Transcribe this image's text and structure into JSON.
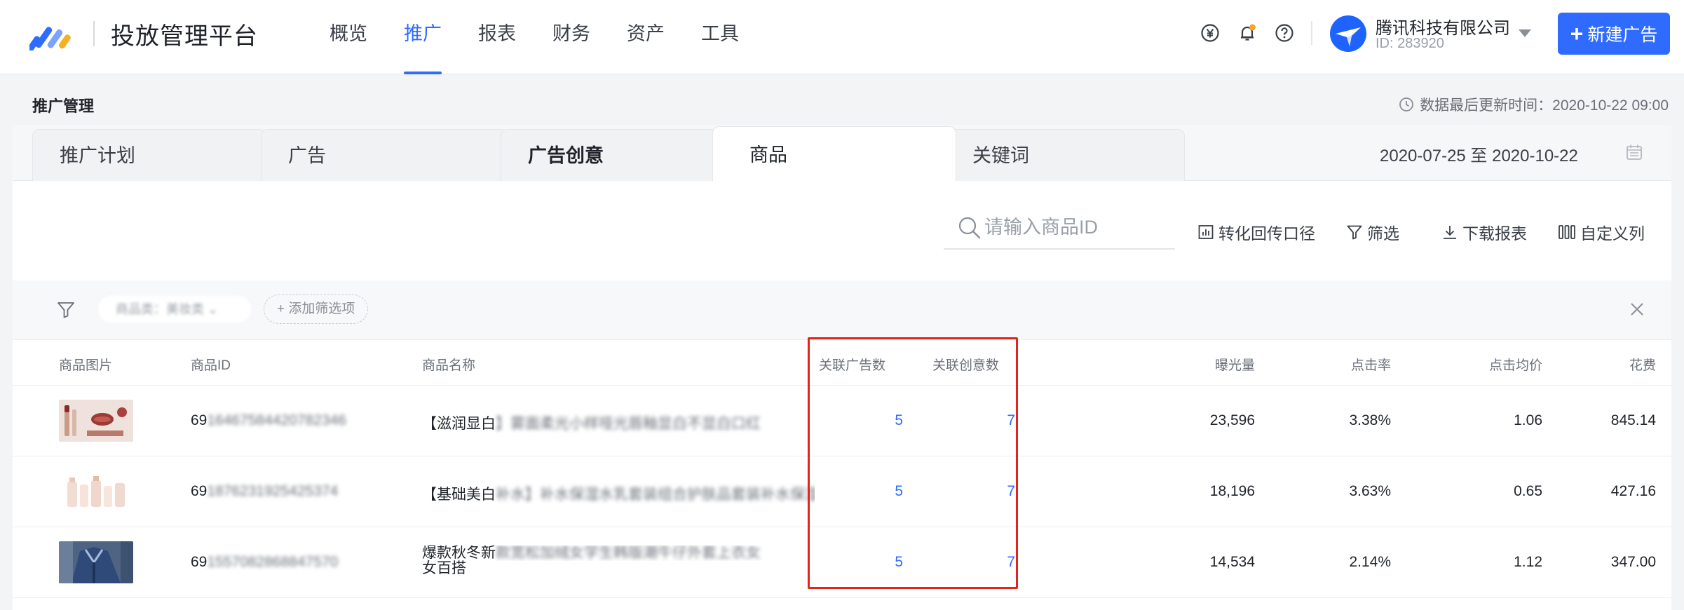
{
  "brand": {
    "name": "投放管理平台",
    "logo_icon": "platform-logo-icon"
  },
  "nav": {
    "items": [
      {
        "label": "概览",
        "active": false
      },
      {
        "label": "推广",
        "active": true
      },
      {
        "label": "报表",
        "active": false
      },
      {
        "label": "财务",
        "active": false
      },
      {
        "label": "资产",
        "active": false
      },
      {
        "label": "工具",
        "active": false
      }
    ]
  },
  "account": {
    "name": "腾讯科技有限公司",
    "id": "ID: 283920"
  },
  "new_ad_button": {
    "plus": "+",
    "label": "新建广告"
  },
  "page": {
    "title": "推广管理",
    "update_time": "数据最后更新时间：2020-10-22 09:00"
  },
  "tabs": [
    {
      "label": "推广计划",
      "bold": false
    },
    {
      "label": "广告",
      "bold": false
    },
    {
      "label": "广告创意",
      "bold": true
    },
    {
      "label": "商品",
      "bold": false,
      "active": true
    },
    {
      "label": "关键词",
      "bold": false
    }
  ],
  "date_range": "2020-07-25 至 2020-10-22",
  "search": {
    "placeholder": "请输入商品ID"
  },
  "actions": {
    "conversion": "转化回传口径",
    "filter": "筛选",
    "download": "下载报表",
    "custom_columns": "自定义列"
  },
  "filter_bar": {
    "chip": "商品类：美妆类 ⌄",
    "add": "+ 添加筛选项"
  },
  "table": {
    "headers": {
      "image": "商品图片",
      "id": "商品ID",
      "name": "商品名称",
      "ads": "关联广告数",
      "creatives": "关联创意数",
      "impressions": "曝光量",
      "ctr": "点击率",
      "cpc": "点击均价",
      "cost": "花费"
    },
    "rows": [
      {
        "id_prefix": "69",
        "id_rest": "16467584420782346",
        "name_prefix": "【滋润显白",
        "name_rest": "】雾面柔光小样哑光唇釉显白不显白口红",
        "ads": "5",
        "creatives": "7",
        "impressions": "23,596",
        "ctr": "3.38%",
        "cpc": "1.06",
        "cost": "845.14"
      },
      {
        "id_prefix": "69",
        "id_rest": "1876231925425374",
        "name_prefix": "【基础美白",
        "name_rest": "补水】补水保湿水乳套装组合护肤品套装补水保湿",
        "ads": "5",
        "creatives": "7",
        "impressions": "18,196",
        "ctr": "3.63%",
        "cpc": "0.65",
        "cost": "427.16"
      },
      {
        "id_prefix": "69",
        "id_rest": "1557082868847570",
        "name_prefix": "爆款秋冬新",
        "name_rest": "款宽松加绒女学生韩版潮牛仔外套上衣女",
        "name_line2": "女百搭",
        "ads": "5",
        "creatives": "7",
        "impressions": "14,534",
        "ctr": "2.14%",
        "cpc": "1.12",
        "cost": "347.00"
      }
    ]
  },
  "colors": {
    "accent": "#2f6bff",
    "highlight": "#e1251b"
  }
}
